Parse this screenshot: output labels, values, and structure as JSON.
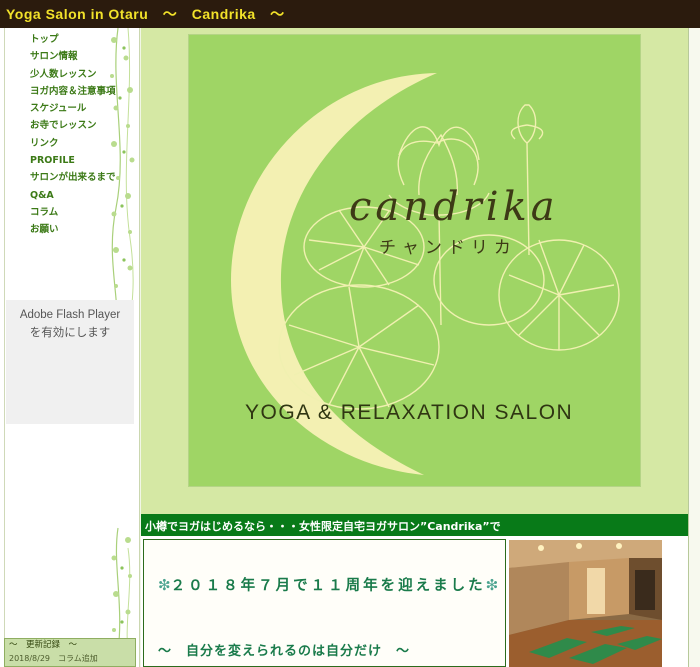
{
  "header": {
    "site_title": "Yoga Salon in Otaru　～　Candrika　～"
  },
  "sidebar": {
    "menu": [
      "トップ",
      "サロン情報",
      "少人数レッスン",
      "ヨガ内容＆注意事項",
      "スケジュール",
      "お寺でレッスン",
      "リンク",
      "PROFILE",
      "サロンが出来るまで",
      "Q&A",
      "コラム",
      "お願い"
    ],
    "flash_notice": "Adobe Flash Player を有効にします",
    "updates_header": "～　更新記録　～",
    "updates_first": "2018/8/29　コラム追加"
  },
  "hero": {
    "brand": "candrika",
    "brand_kana": "チャンドリカ",
    "tagline": "YOGA & RELAXATION SALON"
  },
  "banner": {
    "text": "小樽でヨガはじめるなら・・・女性限定自宅ヨガサロン”Candrika”で"
  },
  "content": {
    "headline_mark": "❇",
    "headline": "２０１８年７月で１１周年を迎えました",
    "subline": "～　自分を変えられるのは自分だけ　～"
  },
  "colors": {
    "topbar": "#2b1b0d",
    "title_text": "#f2e22a",
    "menu_text": "#3c7a17",
    "banner_bg": "#087a18",
    "hero_bg": "#9fd565",
    "moon": "#f3f0b2",
    "headline_text": "#1a7b4b"
  }
}
